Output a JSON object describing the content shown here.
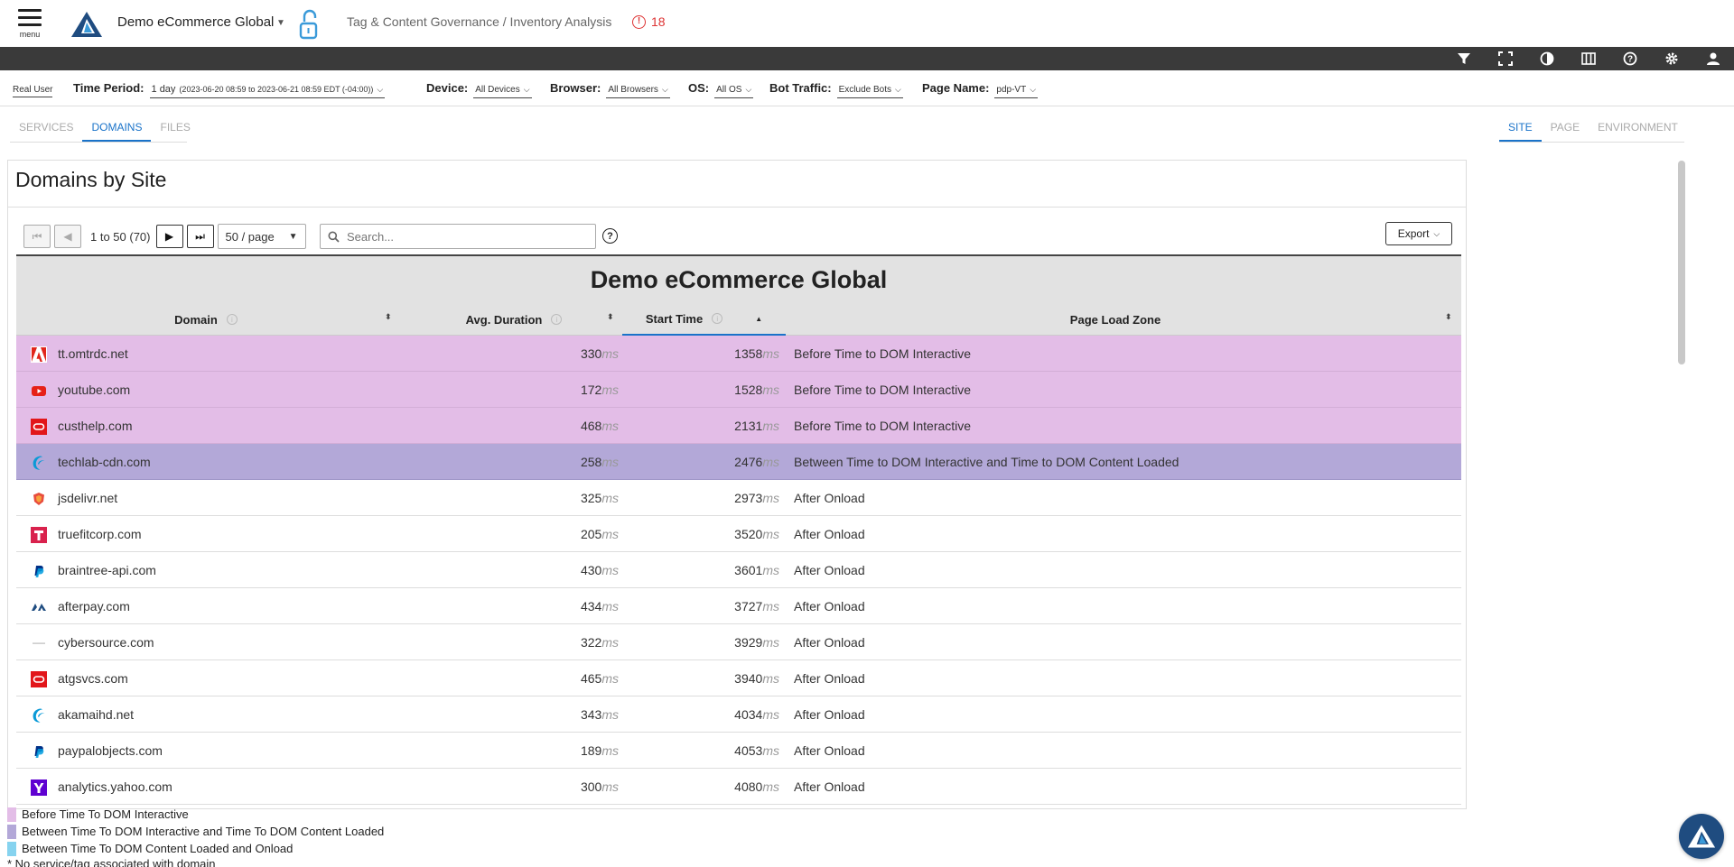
{
  "header": {
    "menu_label": "menu",
    "app_title": "Demo eCommerce Global",
    "breadcrumb": "Tag & Content Governance / Inventory Analysis",
    "alert_count": "18"
  },
  "toolbar_icons": [
    "filter-icon",
    "fullscreen-icon",
    "contrast-icon",
    "columns-icon",
    "help-icon",
    "settings-icon",
    "user-icon"
  ],
  "filters": {
    "data_source": "Real User",
    "time_period_label": "Time Period:",
    "time_period_value": "1 day",
    "time_period_detail": "(2023-06-20 08:59 to 2023-06-21 08:59 EDT (-04:00))",
    "device_label": "Device:",
    "device_value": "All Devices",
    "browser_label": "Browser:",
    "browser_value": "All Browsers",
    "os_label": "OS:",
    "os_value": "All OS",
    "bot_label": "Bot Traffic:",
    "bot_value": "Exclude Bots",
    "page_label": "Page Name:",
    "page_value": "pdp-VT"
  },
  "left_tabs": [
    "SERVICES",
    "DOMAINS",
    "FILES"
  ],
  "right_tabs": [
    "SITE",
    "PAGE",
    "ENVIRONMENT"
  ],
  "panel": {
    "title": "Domains by Site",
    "range": "1 to 50 (70)",
    "page_size": "50 / page",
    "search_placeholder": "Search...",
    "export_label": "Export",
    "table_title": "Demo eCommerce Global"
  },
  "columns": {
    "domain": "Domain",
    "avg_duration": "Avg. Duration",
    "start_time": "Start Time",
    "zone": "Page Load Zone"
  },
  "unit": "ms",
  "rows": [
    {
      "domain": "tt.omtrdc.net",
      "avg": "330",
      "start": "1358",
      "zone": "Before Time to DOM Interactive",
      "kind": "pink",
      "icon": "adobe-icon"
    },
    {
      "domain": "youtube.com",
      "avg": "172",
      "start": "1528",
      "zone": "Before Time to DOM Interactive",
      "kind": "pink",
      "icon": "youtube-icon"
    },
    {
      "domain": "custhelp.com",
      "avg": "468",
      "start": "2131",
      "zone": "Before Time to DOM Interactive",
      "kind": "pink",
      "icon": "oracle-icon"
    },
    {
      "domain": "techlab-cdn.com",
      "avg": "258",
      "start": "2476",
      "zone": "Between Time to DOM Interactive and Time to DOM Content Loaded",
      "kind": "purple",
      "icon": "akamai-icon"
    },
    {
      "domain": "jsdelivr.net",
      "avg": "325",
      "start": "2973",
      "zone": "After Onload",
      "kind": "",
      "icon": "jsdelivr-icon"
    },
    {
      "domain": "truefitcorp.com",
      "avg": "205",
      "start": "3520",
      "zone": "After Onload",
      "kind": "",
      "icon": "truefit-icon"
    },
    {
      "domain": "braintree-api.com",
      "avg": "430",
      "start": "3601",
      "zone": "After Onload",
      "kind": "",
      "icon": "paypal-icon"
    },
    {
      "domain": "afterpay.com",
      "avg": "434",
      "start": "3727",
      "zone": "After Onload",
      "kind": "",
      "icon": "afterpay-icon"
    },
    {
      "domain": "cybersource.com",
      "avg": "322",
      "start": "3929",
      "zone": "After Onload",
      "kind": "",
      "icon": "cybersource-icon"
    },
    {
      "domain": "atgsvcs.com",
      "avg": "465",
      "start": "3940",
      "zone": "After Onload",
      "kind": "",
      "icon": "oracle-icon"
    },
    {
      "domain": "akamaihd.net",
      "avg": "343",
      "start": "4034",
      "zone": "After Onload",
      "kind": "",
      "icon": "akamai-icon"
    },
    {
      "domain": "paypalobjects.com",
      "avg": "189",
      "start": "4053",
      "zone": "After Onload",
      "kind": "",
      "icon": "paypal-icon"
    },
    {
      "domain": "analytics.yahoo.com",
      "avg": "300",
      "start": "4080",
      "zone": "After Onload",
      "kind": "",
      "icon": "yahoo-icon"
    }
  ],
  "legend": [
    {
      "label": "Before Time To DOM Interactive",
      "color": "#e3bde7"
    },
    {
      "label": "Between Time To DOM Interactive and Time To DOM Content Loaded",
      "color": "#b3a8d8"
    },
    {
      "label": "Between Time To DOM Content Loaded and Onload",
      "color": "#86d3ef"
    }
  ],
  "note": "* No service/tag associated with domain"
}
